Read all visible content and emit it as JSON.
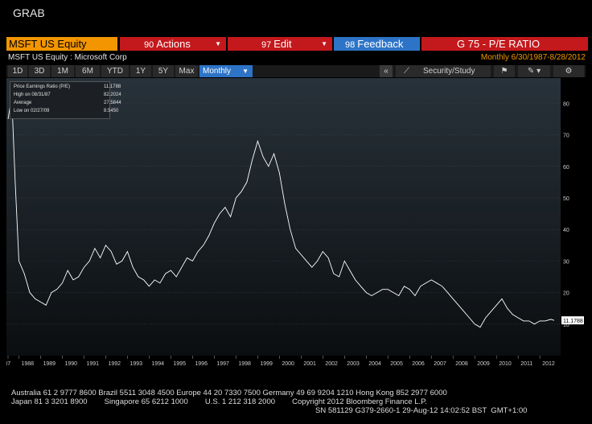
{
  "window": {
    "title": "GRAB"
  },
  "header": {
    "ticker": "MSFT US Equity",
    "actions": {
      "num": "90",
      "label": "Actions"
    },
    "edit": {
      "num": "97",
      "label": "Edit"
    },
    "feedback": {
      "num": "98",
      "label": "Feedback"
    },
    "function": "G 75 - P/E RATIO",
    "subtitle": "MSFT US Equity : Microsoft Corp",
    "range": "Monthly 6/30/1987-8/28/2012"
  },
  "toolbar": {
    "periods": [
      "1D",
      "3D",
      "1M",
      "6M",
      "YTD",
      "1Y",
      "5Y",
      "Max"
    ],
    "frequency": "Monthly",
    "collapse": "«",
    "security_study": "Security/Study"
  },
  "legend": {
    "rows": [
      {
        "label": "Price Earnings Ratio (P/E)",
        "value": "11.1788"
      },
      {
        "label": "High on 08/31/87",
        "value": "82.2024"
      },
      {
        "label": "Average",
        "value": "27.5844"
      },
      {
        "label": "Low on 02/27/09",
        "value": "8.5450"
      }
    ]
  },
  "chart_data": {
    "type": "line",
    "title": "",
    "xlabel": "",
    "ylabel": "",
    "ylim": [
      0,
      88
    ],
    "xlim": [
      1987.5,
      2012.66
    ],
    "y_ticks": [
      "10",
      "20",
      "30",
      "40",
      "50",
      "60",
      "70",
      "80"
    ],
    "x_ticks": [
      "'87",
      "1988",
      "1989",
      "1990",
      "1991",
      "1992",
      "1993",
      "1994",
      "1995",
      "1996",
      "1997",
      "1998",
      "1999",
      "2000",
      "2001",
      "2002",
      "2003",
      "2004",
      "2005",
      "2006",
      "2007",
      "2008",
      "2009",
      "2010",
      "2011",
      "2012"
    ],
    "last_value_label": "11.1788",
    "series": [
      {
        "name": "Price Earnings Ratio (P/E)",
        "x": [
          1987.5,
          1987.67,
          1987.83,
          1988.0,
          1988.25,
          1988.5,
          1988.75,
          1989.0,
          1989.25,
          1989.5,
          1989.75,
          1990.0,
          1990.25,
          1990.5,
          1990.75,
          1991.0,
          1991.25,
          1991.5,
          1991.75,
          1992.0,
          1992.25,
          1992.5,
          1992.75,
          1993.0,
          1993.25,
          1993.5,
          1993.75,
          1994.0,
          1994.25,
          1994.5,
          1994.75,
          1995.0,
          1995.25,
          1995.5,
          1995.75,
          1996.0,
          1996.25,
          1996.5,
          1996.75,
          1997.0,
          1997.25,
          1997.5,
          1997.75,
          1998.0,
          1998.25,
          1998.5,
          1998.75,
          1999.0,
          1999.25,
          1999.5,
          1999.75,
          2000.0,
          2000.25,
          2000.5,
          2000.75,
          2001.0,
          2001.25,
          2001.5,
          2001.75,
          2002.0,
          2002.25,
          2002.5,
          2002.75,
          2003.0,
          2003.25,
          2003.5,
          2003.75,
          2004.0,
          2004.25,
          2004.5,
          2004.75,
          2005.0,
          2005.25,
          2005.5,
          2005.75,
          2006.0,
          2006.25,
          2006.5,
          2006.75,
          2007.0,
          2007.25,
          2007.5,
          2007.75,
          2008.0,
          2008.25,
          2008.5,
          2008.75,
          2009.0,
          2009.25,
          2009.5,
          2009.75,
          2010.0,
          2010.25,
          2010.5,
          2010.75,
          2011.0,
          2011.25,
          2011.5,
          2011.75,
          2012.0,
          2012.25,
          2012.5,
          2012.66
        ],
        "y": [
          75,
          82,
          55,
          30,
          26,
          20,
          18,
          17,
          16,
          20,
          21,
          23,
          27,
          24,
          25,
          28,
          30,
          34,
          31,
          35,
          33,
          29,
          30,
          33,
          28,
          25,
          24,
          22,
          24,
          23,
          26,
          27,
          25,
          28,
          31,
          30,
          33,
          35,
          38,
          42,
          45,
          47,
          44,
          50,
          52,
          55,
          62,
          68,
          63,
          60,
          64,
          58,
          48,
          40,
          34,
          32,
          30,
          28,
          30,
          33,
          31,
          26,
          25,
          30,
          27,
          24,
          22,
          20,
          19,
          20,
          21,
          21,
          20,
          19,
          22,
          21,
          19,
          22,
          23,
          24,
          23,
          22,
          20,
          18,
          16,
          14,
          12,
          10,
          9,
          12,
          14,
          16,
          18,
          15,
          13,
          12,
          11,
          11,
          10,
          11,
          11,
          11.5,
          11.18
        ]
      }
    ]
  },
  "footer": {
    "line1": "Australia 61 2 9777 8600 Brazil 5511 3048 4500 Europe 44 20 7330 7500 Germany 49 69 9204 1210 Hong Kong 852 2977 6000",
    "line2": "Japan 81 3 3201 8900        Singapore 65 6212 1000        U.S. 1 212 318 2000        Copyright 2012 Bloomberg Finance L.P.",
    "line3": "SN 581129 G379-2660-1 29-Aug-12 14:02:52 BST  GMT+1:00"
  },
  "colors": {
    "orange": "#f29500",
    "red_button": "#c3181c",
    "blue_button": "#2d74c7",
    "plot_top": "#28323a",
    "plot_bottom": "#0e1216",
    "line": "#ffffff"
  }
}
